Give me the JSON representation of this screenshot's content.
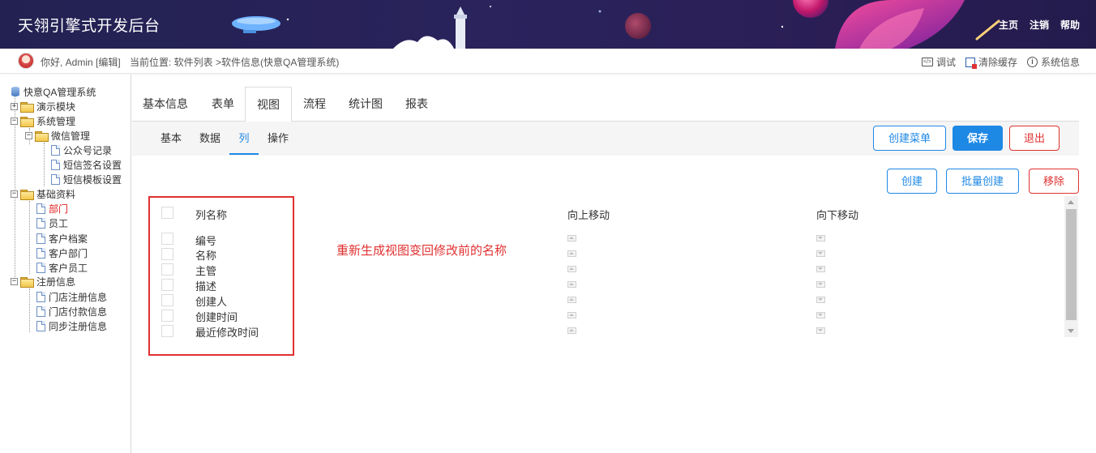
{
  "header": {
    "title": "天翎引擎式开发后台",
    "nav": [
      "主页",
      "注销",
      "帮助"
    ]
  },
  "topbar": {
    "greeting": "你好, Admin",
    "edit": "[编辑]",
    "location": "当前位置: 软件列表 >软件信息(快意QA管理系统)",
    "tools": [
      {
        "icon": "debug-icon",
        "label": "调试"
      },
      {
        "icon": "clear-cache-icon",
        "label": "清除缓存"
      },
      {
        "icon": "info-icon",
        "label": "系统信息"
      }
    ]
  },
  "sidebar": {
    "root": "快意QA管理系统",
    "nodes": [
      {
        "label": "演示模块",
        "type": "folder",
        "expander": "+"
      },
      {
        "label": "系统管理",
        "type": "folder",
        "expander": "-"
      },
      {
        "label": "微信管理",
        "type": "folder",
        "expander": "-"
      },
      {
        "label": "公众号记录",
        "type": "page"
      },
      {
        "label": "短信签名设置",
        "type": "page"
      },
      {
        "label": "短信模板设置",
        "type": "page"
      },
      {
        "label": "基础资料",
        "type": "folder",
        "expander": "-"
      },
      {
        "label": "部门",
        "type": "page",
        "active": true
      },
      {
        "label": "员工",
        "type": "page"
      },
      {
        "label": "客户档案",
        "type": "page"
      },
      {
        "label": "客户部门",
        "type": "page"
      },
      {
        "label": "客户员工",
        "type": "page"
      },
      {
        "label": "注册信息",
        "type": "folder",
        "expander": "-"
      },
      {
        "label": "门店注册信息",
        "type": "page"
      },
      {
        "label": "门店付款信息",
        "type": "page"
      },
      {
        "label": "同步注册信息",
        "type": "page"
      }
    ]
  },
  "main_tabs": [
    "基本信息",
    "表单",
    "视图",
    "流程",
    "统计图",
    "报表"
  ],
  "main_tab_active": "视图",
  "sub_tabs": [
    "基本",
    "数据",
    "列",
    "操作"
  ],
  "sub_tab_active": "列",
  "toolbar": {
    "create_menu": "创建菜单",
    "save": "保存",
    "exit": "退出"
  },
  "actions": {
    "create": "创建",
    "batch_create": "批量创建",
    "remove": "移除"
  },
  "table": {
    "headers": {
      "name": "列名称",
      "up": "向上移动",
      "down": "向下移动"
    },
    "rows": [
      "编号",
      "名称",
      "主管",
      "描述",
      "创建人",
      "创建时间",
      "最近修改时间"
    ]
  },
  "annotation": "重新生成视图变回修改前的名称",
  "colors": {
    "accent": "#1e88e5",
    "danger": "#e03131",
    "header_bg": "#252255"
  }
}
